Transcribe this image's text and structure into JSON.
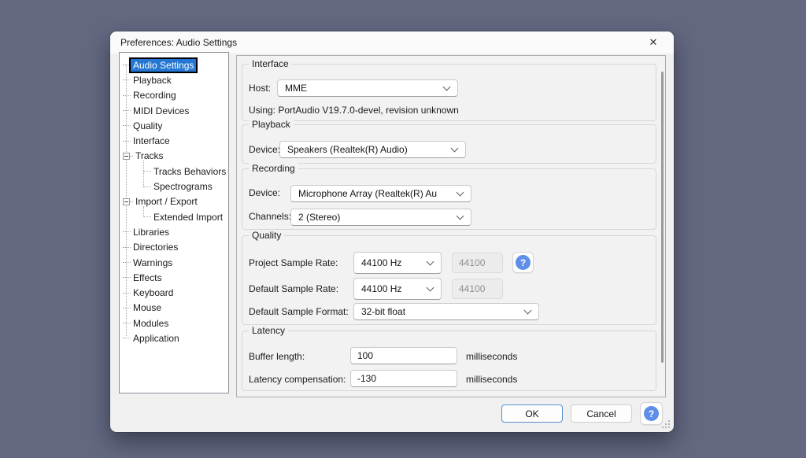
{
  "window": {
    "title": "Preferences: Audio Settings",
    "close_glyph": "✕"
  },
  "tree": {
    "items": [
      {
        "label": "Audio Settings",
        "level": 0,
        "selected": true
      },
      {
        "label": "Playback",
        "level": 0
      },
      {
        "label": "Recording",
        "level": 0
      },
      {
        "label": "MIDI Devices",
        "level": 0
      },
      {
        "label": "Quality",
        "level": 0
      },
      {
        "label": "Interface",
        "level": 0
      },
      {
        "label": "Tracks",
        "level": 0,
        "expander": "minus"
      },
      {
        "label": "Tracks Behaviors",
        "level": 1
      },
      {
        "label": "Spectrograms",
        "level": 1
      },
      {
        "label": "Import / Export",
        "level": 0,
        "expander": "minus"
      },
      {
        "label": "Extended Import",
        "level": 1
      },
      {
        "label": "Libraries",
        "level": 0
      },
      {
        "label": "Directories",
        "level": 0
      },
      {
        "label": "Warnings",
        "level": 0
      },
      {
        "label": "Effects",
        "level": 0
      },
      {
        "label": "Keyboard",
        "level": 0
      },
      {
        "label": "Mouse",
        "level": 0
      },
      {
        "label": "Modules",
        "level": 0
      },
      {
        "label": "Application",
        "level": 0
      }
    ]
  },
  "sections": {
    "interface": {
      "title": "Interface",
      "host_label": "Host:",
      "host_value": "MME",
      "using_text": "Using: PortAudio V19.7.0-devel, revision unknown"
    },
    "playback": {
      "title": "Playback",
      "device_label": "Device:",
      "device_value": "Speakers (Realtek(R) Audio)"
    },
    "recording": {
      "title": "Recording",
      "device_label": "Device:",
      "device_value": "Microphone Array (Realtek(R) Au",
      "channels_label": "Channels:",
      "channels_value": "2 (Stereo)"
    },
    "quality": {
      "title": "Quality",
      "project_rate_label": "Project Sample Rate:",
      "project_rate_value": "44100 Hz",
      "project_rate_actual": "44100",
      "default_rate_label": "Default Sample Rate:",
      "default_rate_value": "44100 Hz",
      "default_rate_actual": "44100",
      "format_label": "Default Sample Format:",
      "format_value": "32-bit float",
      "help_glyph": "?"
    },
    "latency": {
      "title": "Latency",
      "buffer_label": "Buffer length:",
      "buffer_value": "100",
      "buffer_unit": "milliseconds",
      "compensation_label": "Latency compensation:",
      "compensation_value": "-130",
      "compensation_unit": "milliseconds"
    }
  },
  "footer": {
    "ok_label": "OK",
    "cancel_label": "Cancel",
    "help_glyph": "?"
  },
  "colors": {
    "desktop_background": "#636880",
    "selection_blue": "#2577d4",
    "help_blue": "#5d8fe8",
    "ok_border_blue": "#5591d2"
  }
}
